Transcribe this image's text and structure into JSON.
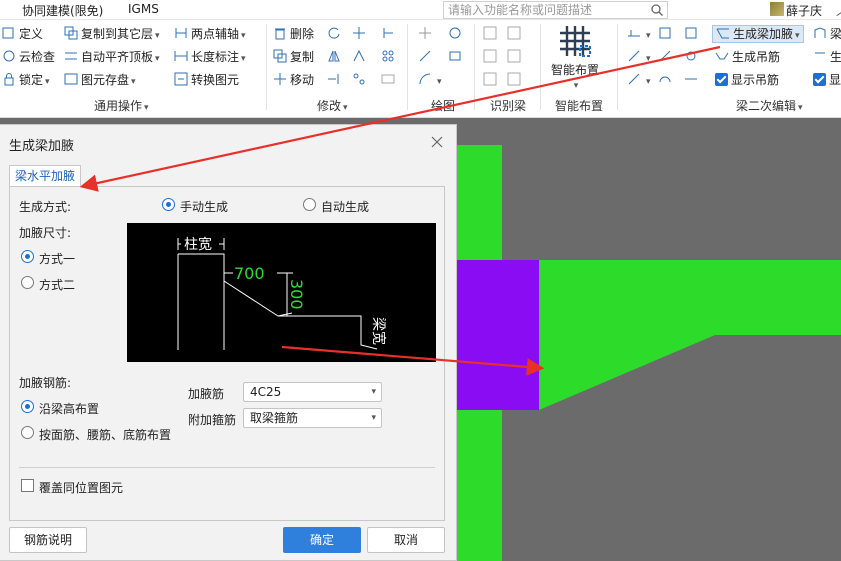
{
  "tabs": {
    "collab": "协同建模(限免)",
    "igms": "IGMS"
  },
  "search": {
    "placeholder": "请输入功能名称或问题描述"
  },
  "user": {
    "name": "薛子庆"
  },
  "ribbon": {
    "common": {
      "define": "定义",
      "copy_to_layer": "复制到其它层",
      "two_point_axis": "两点辅轴",
      "cloud_check": "云检查",
      "auto_flat_slab": "自动平齐顶板",
      "length_mark": "长度标注",
      "lock": "锁定",
      "element_storage": "图元存盘",
      "convert_element": "转换图元",
      "label": "通用操作"
    },
    "modify": {
      "delete": "删除",
      "copy": "复制",
      "move": "移动",
      "label": "修改"
    },
    "draw": {
      "label": "绘图"
    },
    "identify": {
      "label": "识别梁"
    },
    "smart": {
      "button": "智能布置",
      "label": "智能布置"
    },
    "beam": {
      "gen_haunch": "生成梁加腋",
      "gen_hanger": "生成吊筋",
      "show_hanger": "显示吊筋",
      "label": "梁二次编辑",
      "right_col_a": "梁",
      "right_col_b": "生",
      "right_col_c": "显"
    }
  },
  "dialog": {
    "title": "生成梁加腋",
    "tab": "梁水平加腋",
    "gen_method_label": "生成方式:",
    "manual": "手动生成",
    "auto": "自动生成",
    "size_label": "加腋尺寸:",
    "way1": "方式一",
    "way2": "方式二",
    "diagram": {
      "col_width": "柱宽",
      "len": "700",
      "wid": "300",
      "beam_width": "梁宽"
    },
    "rebar_label": "加腋钢筋:",
    "along_height": "沿梁高布置",
    "by_face": "按面筋、腰筋、底筋布置",
    "haunch_bar_label": "加腋筋",
    "haunch_bar_value": "4C25",
    "extra_stirrup_label": "附加箍筋",
    "extra_stirrup_value": "取梁箍筋",
    "cover_same": "覆盖同位置图元",
    "rebar_desc": "钢筋说明",
    "ok": "确定",
    "cancel": "取消"
  },
  "colors": {
    "green": "#2ddc2a",
    "purple": "#8a0cf2",
    "gray": "#6b6b6b",
    "arrow": "#e8302a",
    "accent": "#2f80dd"
  }
}
